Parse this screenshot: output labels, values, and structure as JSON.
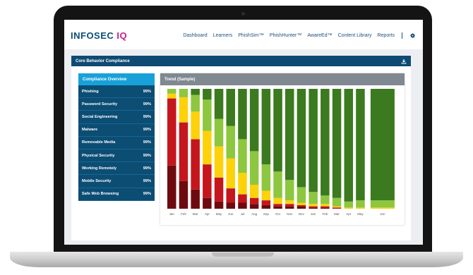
{
  "header": {
    "logo_main": "INFOSEC",
    "logo_accent": "IQ",
    "nav": [
      "Dashboard",
      "Learners",
      "PhishSim™",
      "PhishHunter™",
      "AwareEd™",
      "Content Library",
      "Reports"
    ]
  },
  "panel": {
    "title": "Core Behavior Compliance"
  },
  "compliance": {
    "title": "Compliance Overview",
    "items": [
      {
        "label": "Phishing",
        "value": "99%"
      },
      {
        "label": "Password Security",
        "value": "99%"
      },
      {
        "label": "Social Engineering",
        "value": "99%"
      },
      {
        "label": "Malware",
        "value": "99%"
      },
      {
        "label": "Removable Media",
        "value": "99%"
      },
      {
        "label": "Physical Security",
        "value": "99%"
      },
      {
        "label": "Working Remotely",
        "value": "99%"
      },
      {
        "label": "Mobile Security",
        "value": "99%"
      },
      {
        "label": "Safe Web Browsing",
        "value": "99%"
      }
    ]
  },
  "colors": {
    "dark_red": "#6e0a0f",
    "red": "#c4161c",
    "yellow": "#fdd20a",
    "light_green": "#8dc63f",
    "dark_green": "#3b7a1e",
    "brand_blue": "#0d4e7a",
    "brand_magenta": "#c4208c"
  },
  "chart_data": {
    "type": "bar",
    "title": "Trend (Sample)",
    "stacked": true,
    "categories": [
      "Jan",
      "Feb",
      "Mar",
      "Apr",
      "May",
      "Jun",
      "Jul",
      "Aug",
      "Sep",
      "Oct",
      "Nov",
      "Dec",
      "Jan",
      "Feb",
      "Mar",
      "Apr",
      "May",
      "Jun"
    ],
    "series": [
      {
        "color": "#6e0a0f",
        "values": [
          36,
          23,
          16,
          9,
          6,
          5,
          5,
          4,
          3,
          2,
          2,
          2,
          1,
          1,
          0,
          0,
          0,
          0
        ]
      },
      {
        "color": "#c4161c",
        "values": [
          56,
          49,
          42,
          28,
          20,
          12,
          7,
          5,
          4,
          2,
          2,
          1,
          1,
          1,
          1,
          0,
          0,
          0
        ]
      },
      {
        "color": "#fdd20a",
        "values": [
          4,
          21,
          23,
          28,
          26,
          25,
          18,
          11,
          8,
          5,
          3,
          2,
          2,
          2,
          1,
          1,
          1,
          1
        ]
      },
      {
        "color": "#8dc63f",
        "values": [
          4,
          7,
          14,
          26,
          23,
          27,
          28,
          28,
          22,
          22,
          17,
          13,
          10,
          7,
          7,
          5,
          6,
          6
        ]
      },
      {
        "color": "#3b7a1e",
        "values": [
          0,
          0,
          5,
          9,
          25,
          31,
          42,
          52,
          63,
          69,
          76,
          82,
          86,
          89,
          91,
          94,
          93,
          93
        ]
      }
    ],
    "ylim": [
      0,
      100
    ],
    "gap_before_last": true
  }
}
